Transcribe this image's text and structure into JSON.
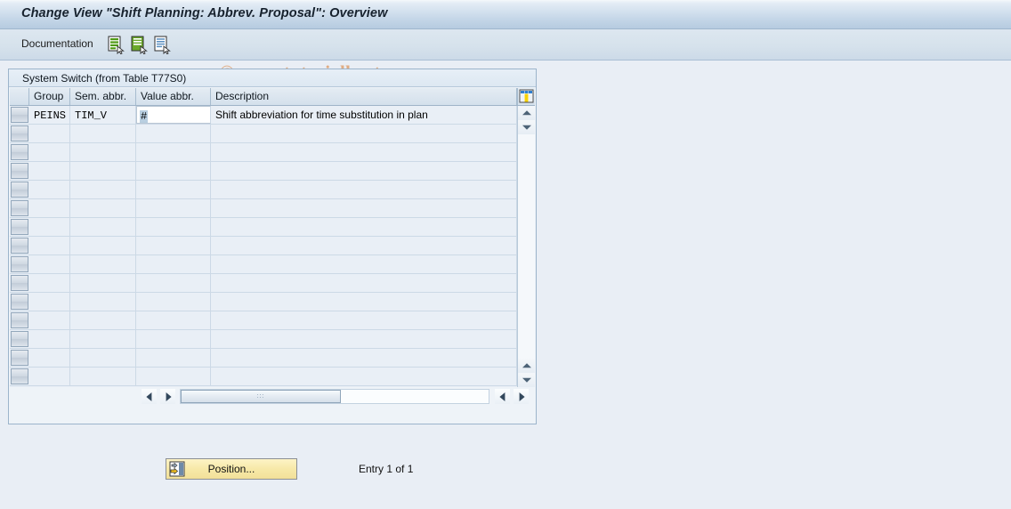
{
  "window": {
    "title": "Change View \"Shift Planning: Abbrev. Proposal\": Overview"
  },
  "toolbar": {
    "documentation_label": "Documentation",
    "icons": [
      {
        "name": "documentation-green-doc-icon",
        "title": "Documentation"
      },
      {
        "name": "documentation-green-solid-doc-icon",
        "title": "Documentation"
      },
      {
        "name": "documentation-blue-lines-doc-icon",
        "title": "Documentation"
      }
    ]
  },
  "watermark": {
    "text": "© www.tutorialkart.com"
  },
  "panel": {
    "title": "System Switch (from Table T77S0)"
  },
  "grid": {
    "columns": [
      {
        "key": "select",
        "label": ""
      },
      {
        "key": "group",
        "label": "Group"
      },
      {
        "key": "sem_abbr",
        "label": "Sem. abbr."
      },
      {
        "key": "value_abbr",
        "label": "Value abbr."
      },
      {
        "key": "description",
        "label": "Description"
      }
    ],
    "config_icon": "column-settings-icon",
    "rows": [
      {
        "group": "PEINS",
        "sem_abbr": "TIM_V",
        "value_abbr": "#",
        "value_abbr_selected": true,
        "description": "Shift abbreviation for time substitution in plan"
      }
    ],
    "empty_row_count": 14
  },
  "scrollbars": {
    "vertical": {
      "up_icon": "scroll-up-arrow-icon",
      "down_icon": "scroll-down-arrow-icon"
    },
    "horizontal": {
      "left_icon": "scroll-left-arrow-icon",
      "right_icon": "scroll-right-arrow-icon",
      "thumb_grip": "∶∶∶"
    }
  },
  "footer": {
    "position_button_label": "Position...",
    "position_button_icon": "position-jump-icon",
    "entry_status": "Entry 1 of 1"
  },
  "colors": {
    "title_bar": "#c3d5e7",
    "toolbar": "#d6e2ec",
    "panel_bg": "#eef3f8",
    "grid_row": "#e9eff6",
    "watermark": "#e0ac83",
    "button_yellow": "#f7e9a8"
  }
}
